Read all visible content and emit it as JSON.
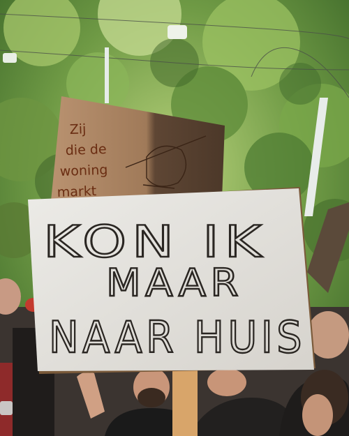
{
  "scene": {
    "type": "protest photograph",
    "colors": {
      "trees": "#5f8f3a",
      "sky_highlight": "#d8e8b8",
      "front_sign": "#e3e1dc",
      "back_sign": "#9a7453",
      "pole": "#d9a76b",
      "ink": "#2a2622",
      "back_ink": "#6a2d12"
    }
  },
  "back_sign": {
    "lines": [
      "Zij",
      "die de",
      "woning",
      "markt"
    ]
  },
  "front_sign": {
    "line1": "KON IK",
    "line2": "MAAR",
    "line3": "NAAR HUIS"
  }
}
